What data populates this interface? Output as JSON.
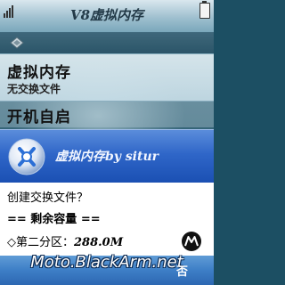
{
  "app": {
    "title": "V8虚拟内存"
  },
  "list": {
    "items": [
      {
        "label": "虚拟内存",
        "sub": "无交换文件"
      },
      {
        "label": "开机自启"
      }
    ]
  },
  "dialog": {
    "title": "虚拟内存by situr",
    "question": "创建交换文件？",
    "remaining": "== 剩余容量 ==",
    "partition_label": "◇第二分区：",
    "partition_value": "288.0M"
  },
  "softkeys": {
    "right": "否"
  },
  "watermark": "Moto.BlackArm.net",
  "colors": {
    "header_blue": "#2f66c8",
    "softbar_blue": "#3d7ec6",
    "list_highlight": "#d3e5ec"
  },
  "icons": [
    "signal-icon",
    "battery-icon",
    "menu-icon",
    "app-logo-icon",
    "motorola-logo-icon"
  ]
}
